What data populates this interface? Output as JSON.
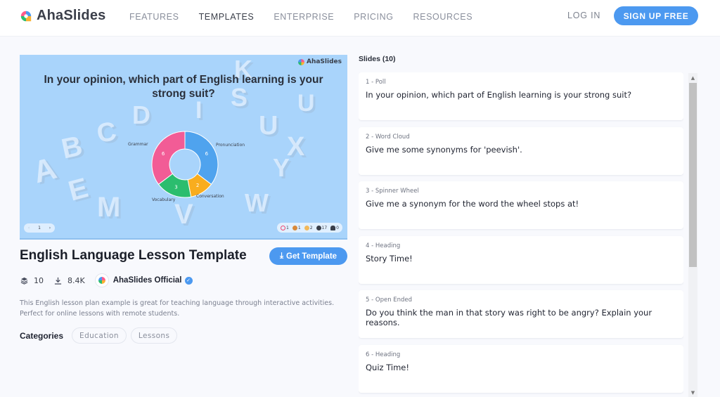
{
  "header": {
    "brand": "AhaSlides",
    "nav": [
      {
        "label": "FEATURES",
        "active": false
      },
      {
        "label": "TEMPLATES",
        "active": true
      },
      {
        "label": "ENTERPRISE",
        "active": false
      },
      {
        "label": "PRICING",
        "active": false
      },
      {
        "label": "RESOURCES",
        "active": false
      }
    ],
    "login_label": "LOG IN",
    "signup_label": "SIGN UP FREE"
  },
  "preview": {
    "brand": "AhaSlides",
    "question": "In your opinion, which part of English learning is your strong suit?",
    "chart": {
      "type": "donut",
      "slices": [
        {
          "label": "Pronunciation",
          "value": 6,
          "color": "#4fa3ee"
        },
        {
          "label": "Conversation",
          "value": 2,
          "color": "#f9ad1e"
        },
        {
          "label": "Vocabulary",
          "value": 3,
          "color": "#2bbd6e"
        },
        {
          "label": "Grammar",
          "value": 6,
          "color": "#f25c96"
        }
      ]
    },
    "pager": {
      "prev": "‹",
      "page": "1",
      "next": "›"
    },
    "reactions": [
      {
        "name": "heart",
        "count": "1",
        "color": "#f0466e"
      },
      {
        "name": "laugh",
        "count": "1",
        "color": "#d8893a"
      },
      {
        "name": "wow",
        "count": "2",
        "color": "#f2b85a"
      },
      {
        "name": "responses",
        "count": "17",
        "color": "#3a3f4a"
      },
      {
        "name": "audience",
        "count": "0",
        "color": "#3a3f4a"
      }
    ]
  },
  "template": {
    "title": "English Language Lesson Template",
    "get_label": "Get Template",
    "slides_count": "10",
    "downloads": "8.4K",
    "author": "AhaSlides Official",
    "description": "This English lesson plan example is great for teaching language through interactive activities. Perfect for online lessons with remote students.",
    "categories_label": "Categories",
    "categories": [
      "Education",
      "Lessons"
    ]
  },
  "slides": {
    "heading": "Slides (10)",
    "items": [
      {
        "kind": "1 - Poll",
        "text": "In your opinion, which part of English learning is your strong suit?"
      },
      {
        "kind": "2 - Word Cloud",
        "text": "Give me some synonyms for 'peevish'."
      },
      {
        "kind": "3 - Spinner Wheel",
        "text": "Give me a synonym for the word the wheel stops at!"
      },
      {
        "kind": "4 - Heading",
        "text": "Story Time!"
      },
      {
        "kind": "5 - Open Ended",
        "text": "Do you think the man in that story was right to be angry? Explain your reasons."
      },
      {
        "kind": "6 - Heading",
        "text": "Quiz Time!"
      }
    ]
  }
}
